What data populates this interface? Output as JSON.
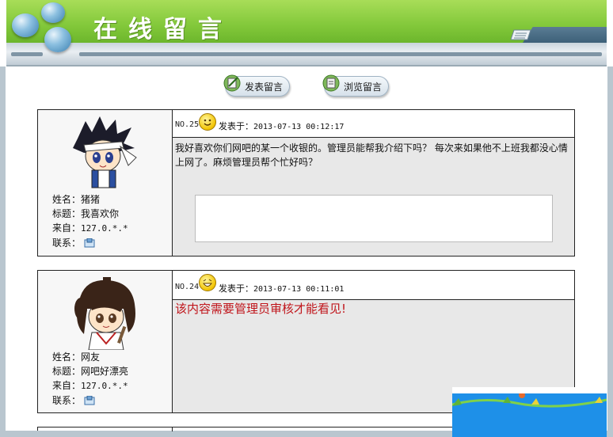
{
  "header": {
    "title": "在线留言"
  },
  "nav": {
    "post_label": "发表留言",
    "browse_label": "浏览留言"
  },
  "labels": {
    "posted_prefix": "发表于：",
    "name": "姓名：",
    "title": "标题：",
    "from": "来自：",
    "contact": "联系："
  },
  "messages": [
    {
      "no": "NO.25",
      "time": "2013-07-13 00:12:17",
      "content": "我好喜欢你们网吧的某一个收银的。管理员能帮我介绍下吗？ 每次来如果他不上班我都没心情上网了。麻烦管理员帮个忙好吗？",
      "name": "猪猪",
      "subject": "我喜欢你",
      "ip": "127.0.*.*",
      "emoticon": "smile-icon",
      "avatar": "anime-boy-avatar"
    },
    {
      "no": "NO.24",
      "time": "2013-07-13 00:11:01",
      "content": "该内容需要管理员审核才能看见!",
      "name": "网友",
      "subject": "网吧好漂亮",
      "ip": "127.0.*.*",
      "emoticon": "grin-icon",
      "avatar": "anime-girl-avatar"
    }
  ],
  "colors": {
    "banner_green": "#82c83a",
    "hidden_notice": "#c0151b",
    "popup_blue": "#1e90e8"
  }
}
